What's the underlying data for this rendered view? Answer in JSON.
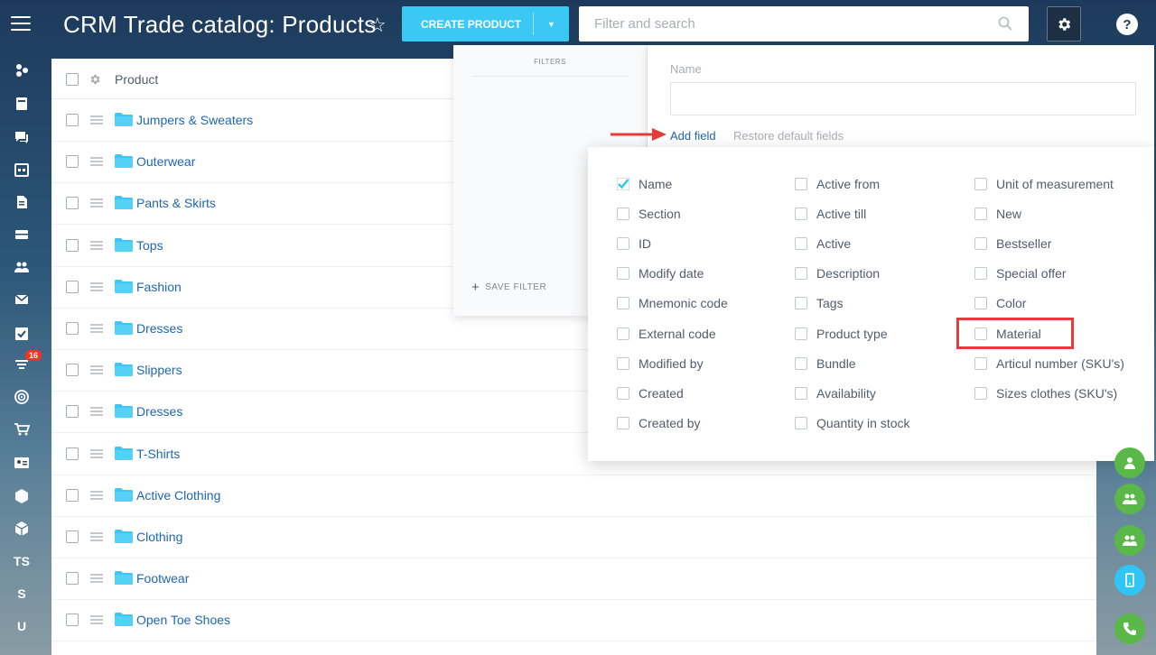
{
  "header": {
    "title": "CRM Trade catalog: Products",
    "create_label": "CREATE PRODUCT",
    "search_placeholder": "Filter and search"
  },
  "leftnav": {
    "badge_count": "16",
    "text_items": [
      "TS",
      "S",
      "U"
    ]
  },
  "list": {
    "column_header": "Product",
    "rows": [
      "Jumpers & Sweaters",
      "Outerwear",
      "Pants & Skirts",
      "Tops",
      "Fashion",
      "Dresses",
      "Slippers",
      "Dresses",
      "T-Shirts",
      "Active Clothing",
      "Clothing",
      "Footwear",
      "Open Toe Shoes"
    ]
  },
  "filter": {
    "title": "FILTERS",
    "save_label": "SAVE FILTER",
    "name_label": "Name",
    "add_field": "Add field",
    "restore": "Restore default fields"
  },
  "fields": {
    "col1": [
      {
        "label": "Name",
        "checked": true
      },
      {
        "label": "Section",
        "checked": false
      },
      {
        "label": "ID",
        "checked": false
      },
      {
        "label": "Modify date",
        "checked": false
      },
      {
        "label": "Mnemonic code",
        "checked": false
      },
      {
        "label": "External code",
        "checked": false
      },
      {
        "label": "Modified by",
        "checked": false
      },
      {
        "label": "Created",
        "checked": false
      },
      {
        "label": "Created by",
        "checked": false
      }
    ],
    "col2": [
      {
        "label": "Active from",
        "checked": false
      },
      {
        "label": "Active till",
        "checked": false
      },
      {
        "label": "Active",
        "checked": false
      },
      {
        "label": "Description",
        "checked": false
      },
      {
        "label": "Tags",
        "checked": false
      },
      {
        "label": "Product type",
        "checked": false
      },
      {
        "label": "Bundle",
        "checked": false
      },
      {
        "label": "Availability",
        "checked": false
      },
      {
        "label": "Quantity in stock",
        "checked": false
      }
    ],
    "col3": [
      {
        "label": "Unit of measurement",
        "checked": false
      },
      {
        "label": "New",
        "checked": false
      },
      {
        "label": "Bestseller",
        "checked": false
      },
      {
        "label": "Special offer",
        "checked": false
      },
      {
        "label": "Color",
        "checked": false
      },
      {
        "label": "Material",
        "checked": false
      },
      {
        "label": "Articul number (SKU's)",
        "checked": false
      },
      {
        "label": "Sizes clothes (SKU's)",
        "checked": false
      }
    ]
  },
  "colors": {
    "accent": "#3bc8f5",
    "link": "#2067b0",
    "highlight": "#e63b3b",
    "rail_green": "#59b847",
    "badge": "#f1361b"
  }
}
